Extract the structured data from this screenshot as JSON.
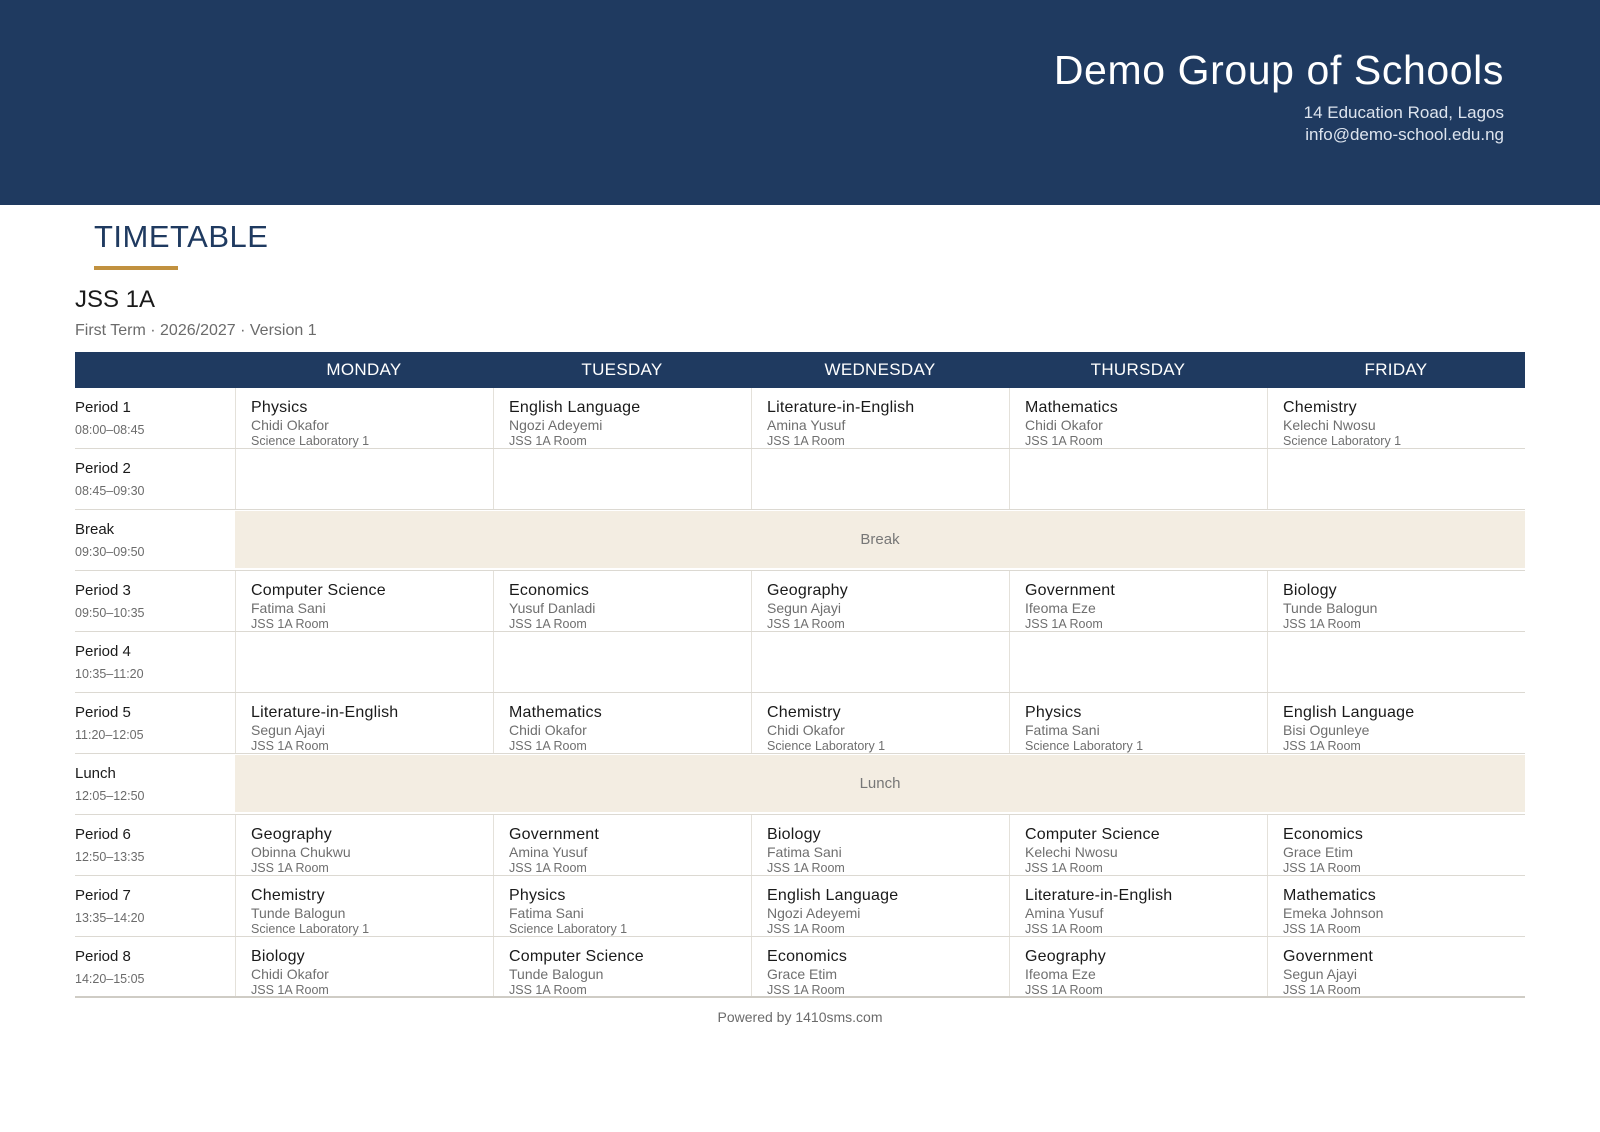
{
  "header": {
    "school_name": "Demo Group of Schools",
    "address": "14 Education Road, Lagos",
    "email": "info@demo-school.edu.ng"
  },
  "document": {
    "title": "TIMETABLE",
    "class_name": "JSS 1A",
    "term": "First Term · 2026/2027  ·  Version 1"
  },
  "days": [
    "MONDAY",
    "TUESDAY",
    "WEDNESDAY",
    "THURSDAY",
    "FRIDAY"
  ],
  "rows": [
    {
      "name": "Period 1",
      "time": "08:00–08:45",
      "cells": [
        {
          "subject": "Physics",
          "teacher": "Chidi Okafor",
          "room": "Science Laboratory 1"
        },
        {
          "subject": "English Language",
          "teacher": "Ngozi Adeyemi",
          "room": "JSS 1A Room"
        },
        {
          "subject": "Literature-in-English",
          "teacher": "Amina Yusuf",
          "room": "JSS 1A Room"
        },
        {
          "subject": "Mathematics",
          "teacher": "Chidi Okafor",
          "room": "JSS 1A Room"
        },
        {
          "subject": "Chemistry",
          "teacher": "Kelechi Nwosu",
          "room": "Science Laboratory 1"
        }
      ]
    },
    {
      "name": "Period 2",
      "time": "08:45–09:30",
      "cells": [
        {
          "subject": "",
          "teacher": "",
          "room": ""
        },
        {
          "subject": "",
          "teacher": "",
          "room": ""
        },
        {
          "subject": "",
          "teacher": "",
          "room": ""
        },
        {
          "subject": "",
          "teacher": "",
          "room": ""
        },
        {
          "subject": "",
          "teacher": "",
          "room": ""
        }
      ]
    },
    {
      "name": "Break",
      "time": "09:30–09:50",
      "band": "Break"
    },
    {
      "name": "Period 3",
      "time": "09:50–10:35",
      "cells": [
        {
          "subject": "Computer Science",
          "teacher": "Fatima Sani",
          "room": "JSS 1A Room"
        },
        {
          "subject": "Economics",
          "teacher": "Yusuf Danladi",
          "room": "JSS 1A Room"
        },
        {
          "subject": "Geography",
          "teacher": "Segun Ajayi",
          "room": "JSS 1A Room"
        },
        {
          "subject": "Government",
          "teacher": "Ifeoma Eze",
          "room": "JSS 1A Room"
        },
        {
          "subject": "Biology",
          "teacher": "Tunde Balogun",
          "room": "JSS 1A Room"
        }
      ]
    },
    {
      "name": "Period 4",
      "time": "10:35–11:20",
      "cells": [
        {
          "subject": "",
          "teacher": "",
          "room": ""
        },
        {
          "subject": "",
          "teacher": "",
          "room": ""
        },
        {
          "subject": "",
          "teacher": "",
          "room": ""
        },
        {
          "subject": "",
          "teacher": "",
          "room": ""
        },
        {
          "subject": "",
          "teacher": "",
          "room": ""
        }
      ]
    },
    {
      "name": "Period 5",
      "time": "11:20–12:05",
      "cells": [
        {
          "subject": "Literature-in-English",
          "teacher": "Segun Ajayi",
          "room": "JSS 1A Room"
        },
        {
          "subject": "Mathematics",
          "teacher": "Chidi Okafor",
          "room": "JSS 1A Room"
        },
        {
          "subject": "Chemistry",
          "teacher": "Chidi Okafor",
          "room": "Science Laboratory 1"
        },
        {
          "subject": "Physics",
          "teacher": "Fatima Sani",
          "room": "Science Laboratory 1"
        },
        {
          "subject": "English Language",
          "teacher": "Bisi Ogunleye",
          "room": "JSS 1A Room"
        }
      ]
    },
    {
      "name": "Lunch",
      "time": "12:05–12:50",
      "band": "Lunch"
    },
    {
      "name": "Period 6",
      "time": "12:50–13:35",
      "cells": [
        {
          "subject": "Geography",
          "teacher": "Obinna Chukwu",
          "room": "JSS 1A Room"
        },
        {
          "subject": "Government",
          "teacher": "Amina Yusuf",
          "room": "JSS 1A Room"
        },
        {
          "subject": "Biology",
          "teacher": "Fatima Sani",
          "room": "JSS 1A Room"
        },
        {
          "subject": "Computer Science",
          "teacher": "Kelechi Nwosu",
          "room": "JSS 1A Room"
        },
        {
          "subject": "Economics",
          "teacher": "Grace Etim",
          "room": "JSS 1A Room"
        }
      ]
    },
    {
      "name": "Period 7",
      "time": "13:35–14:20",
      "cells": [
        {
          "subject": "Chemistry",
          "teacher": "Tunde Balogun",
          "room": "Science Laboratory 1"
        },
        {
          "subject": "Physics",
          "teacher": "Fatima Sani",
          "room": "Science Laboratory 1"
        },
        {
          "subject": "English Language",
          "teacher": "Ngozi Adeyemi",
          "room": "JSS 1A Room"
        },
        {
          "subject": "Literature-in-English",
          "teacher": "Amina Yusuf",
          "room": "JSS 1A Room"
        },
        {
          "subject": "Mathematics",
          "teacher": "Emeka Johnson",
          "room": "JSS 1A Room"
        }
      ]
    },
    {
      "name": "Period 8",
      "time": "14:20–15:05",
      "cells": [
        {
          "subject": "Biology",
          "teacher": "Chidi Okafor",
          "room": "JSS 1A Room"
        },
        {
          "subject": "Computer Science",
          "teacher": "Tunde Balogun",
          "room": "JSS 1A Room"
        },
        {
          "subject": "Economics",
          "teacher": "Grace Etim",
          "room": "JSS 1A Room"
        },
        {
          "subject": "Geography",
          "teacher": "Ifeoma Eze",
          "room": "JSS 1A Room"
        },
        {
          "subject": "Government",
          "teacher": "Segun Ajayi",
          "room": "JSS 1A Room"
        }
      ]
    }
  ],
  "footer": {
    "text": "Powered by 1410sms.com"
  },
  "colors": {
    "brand": "#1f3a60",
    "accent": "#c1913f",
    "band": "#f3ede2"
  }
}
